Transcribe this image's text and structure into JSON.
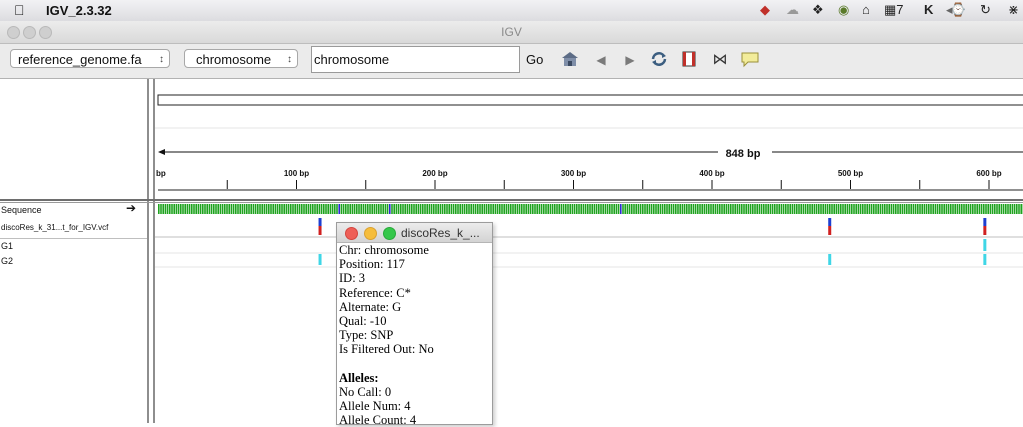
{
  "menubar": {
    "app_name": "IGV_2.3.32"
  },
  "window": {
    "title": "IGV"
  },
  "toolbar": {
    "genome": "reference_genome.fa",
    "chromosome": "chromosome",
    "locus": "chromosome",
    "go_label": "Go"
  },
  "ruler": {
    "span_label": "848 bp",
    "start_label": "bp",
    "ticks": [
      "100 bp",
      "200 bp",
      "300 bp",
      "400 bp",
      "500 bp",
      "600 bp"
    ]
  },
  "tracks": {
    "sequence": "Sequence",
    "vcf": "discoRes_k_31...t_for_IGV.vcf",
    "samples": [
      "G1",
      "G2"
    ]
  },
  "popup": {
    "title": "discoRes_k_...",
    "lines": [
      "Chr: chromosome",
      "Position: 117",
      "ID: 3",
      "Reference: C*",
      "Alternate: G",
      "Qual: -10",
      "Type: SNP",
      "Is Filtered Out: No",
      "",
      "Alleles:",
      "No Call: 0",
      "Allele Num: 4",
      "Allele Count: 4"
    ]
  },
  "colors": {
    "base_A": "#1fa31f",
    "base_C": "#2b2bd4",
    "base_G": "#d48a16",
    "base_T": "#d42b2b",
    "variant_ref": "#1e3fd0",
    "variant_alt": "#d02020",
    "genotype": "#3fd6e6"
  },
  "icons": [
    "apple-icon",
    "home-icon",
    "back-icon",
    "forward-icon",
    "refresh-icon",
    "roi-icon",
    "fit-icon",
    "popup-text-icon"
  ]
}
